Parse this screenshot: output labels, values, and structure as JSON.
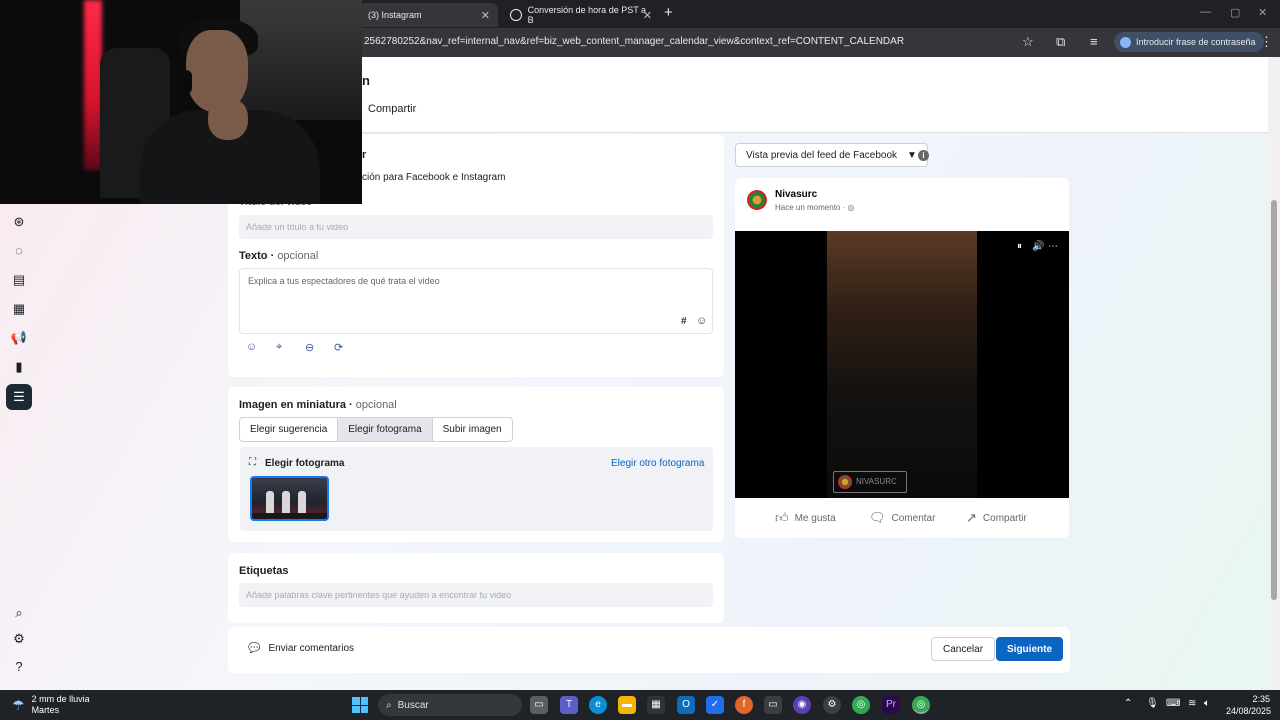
{
  "browser": {
    "tabs": [
      {
        "title": "(3) Instagram",
        "active": true
      },
      {
        "title": "Conversión de hora de PST a B",
        "active": false
      }
    ],
    "url": "2562780252&nav_ref=internal_nav&ref=biz_web_content_manager_calendar_view&context_ref=CONTENT_CALENDAR",
    "passphrase_label": "Introducir frase de contraseña"
  },
  "header": {
    "heading_fragment": "n",
    "share_tab": "Compartir"
  },
  "form": {
    "section_fragment_top": "r",
    "section_subtitle_fragment": "ción para Facebook e Instagram",
    "title_label": "Título del video",
    "title_placeholder": "Añade un título a tu video",
    "text_label": "Texto",
    "text_optional": "opcional",
    "text_placeholder": "Explica a tus espectadores de qué trata el video",
    "hashtag_symbol": "#",
    "thumbnail_label": "Imagen en miniatura",
    "thumbnail_optional": "opcional",
    "thumbnail_options": [
      "Elegir sugerencia",
      "Elegir fotograma",
      "Subir imagen"
    ],
    "thumbnail_selected": "Elegir fotograma",
    "choose_frame_title": "Elegir fotograma",
    "choose_other_frame": "Elegir otro fotograma",
    "tags_label": "Etiquetas",
    "tags_placeholder": "Añade palabras clave pertinentes que ayuden a encontrar tu video"
  },
  "preview": {
    "mode_label": "Vista previa del feed de Facebook",
    "page_name": "Nivasurc",
    "time": "Hace un momento",
    "watermark_text": "NIVASURC",
    "actions": [
      "Me gusta",
      "Comentar",
      "Compartir"
    ]
  },
  "footer": {
    "feedback": "Enviar comentarios",
    "cancel": "Cancelar",
    "next": "Siguiente"
  },
  "taskbar": {
    "weather_line1": "2 mm de lluvia",
    "weather_line2": "Martes",
    "search": "Buscar",
    "premiere_label": "Pr",
    "time": "2:35",
    "date": "24/08/2025"
  },
  "colors": {
    "accent": "#0a66c2",
    "rail_active": "#1c2b33",
    "taskbar": "#1f2226"
  }
}
